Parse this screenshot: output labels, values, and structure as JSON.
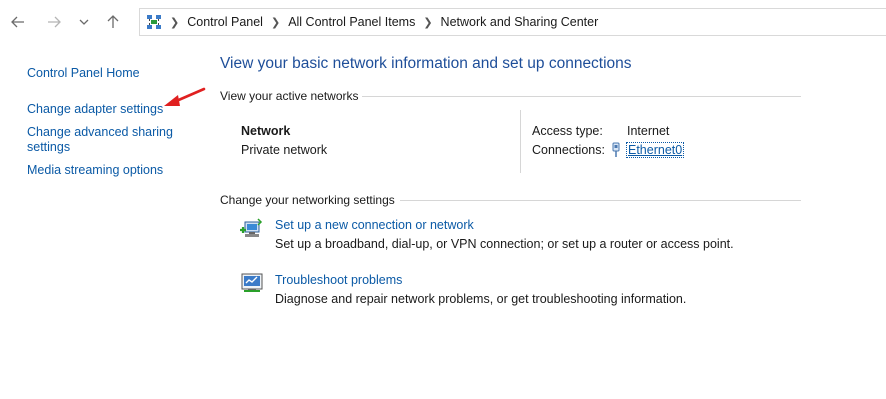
{
  "nav": {
    "back_icon": "arrow-left-icon",
    "forward_icon": "arrow-right-icon",
    "recent_icon": "chevron-down-icon",
    "up_icon": "arrow-up-icon"
  },
  "breadcrumb": {
    "items": [
      "Control Panel",
      "All Control Panel Items",
      "Network and Sharing Center"
    ]
  },
  "sidebar": {
    "items": [
      {
        "label": "Control Panel Home"
      },
      {
        "label": "Change adapter settings"
      },
      {
        "label": "Change advanced sharing\nsettings"
      },
      {
        "label": "Media streaming options"
      }
    ]
  },
  "main": {
    "title": "View your basic network information and set up connections",
    "active_networks": {
      "header": "View your active networks",
      "network_name": "Network",
      "network_type": "Private network",
      "access_type_label": "Access type:",
      "access_type_value": "Internet",
      "connections_label": "Connections:",
      "connections_value": "Ethernet0"
    },
    "settings": {
      "header": "Change your networking settings",
      "items": [
        {
          "title": "Set up a new connection or network",
          "desc": "Set up a broadband, dial-up, or VPN connection; or set up a router or access point."
        },
        {
          "title": "Troubleshoot problems",
          "desc": "Diagnose and repair network problems, or get troubleshooting information."
        }
      ]
    }
  },
  "annotation": {
    "arrow_color": "#e02020"
  },
  "colors": {
    "link": "#0b5aa6",
    "title": "#1e4e99"
  }
}
